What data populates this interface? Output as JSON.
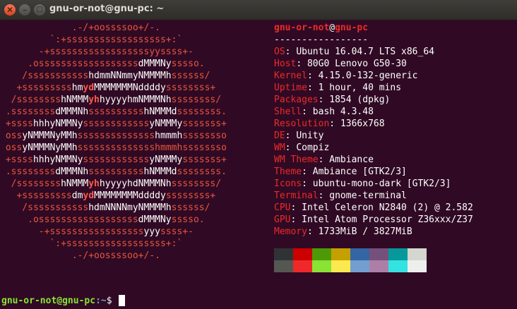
{
  "window": {
    "title": "gnu-or-not@gnu-pc: ~",
    "close_glyph": "✕",
    "minimize_glyph": "–",
    "maximize_glyph": "□"
  },
  "colors": {
    "background": "#300a24",
    "titlebar": "#3c3b37",
    "accent_red": "#ef2929",
    "logo_red": "#e9563e",
    "prompt_green": "#8ae234",
    "prompt_blue": "#729fcf"
  },
  "logo_lines": [
    [
      {
        "t": "             .-/+oossssoo+/-.",
        "s": "r"
      }
    ],
    [
      {
        "t": "         `:+ssssssssssssssssss+:`",
        "s": "r"
      }
    ],
    [
      {
        "t": "       -+ssssssssssssssssssyyssss+-",
        "s": "r"
      }
    ],
    [
      {
        "t": "     .ossssssssssssssssss",
        "s": "r"
      },
      {
        "t": "dMMMNy",
        "s": "w"
      },
      {
        "t": "sssso.",
        "s": "r"
      }
    ],
    [
      {
        "t": "    /sssssssssss",
        "s": "r"
      },
      {
        "t": "hdmmNNmmyNMMMMh",
        "s": "w"
      },
      {
        "t": "ssssss/",
        "s": "r"
      }
    ],
    [
      {
        "t": "   +sssssssss",
        "s": "r"
      },
      {
        "t": "hm",
        "s": "w"
      },
      {
        "t": "yd",
        "s": "b"
      },
      {
        "t": "MMMMMMMNddddy",
        "s": "w"
      },
      {
        "t": "ssssssss+",
        "s": "r"
      }
    ],
    [
      {
        "t": "  /ssssssss",
        "s": "r"
      },
      {
        "t": "hNMMM",
        "s": "w"
      },
      {
        "t": "yh",
        "s": "b"
      },
      {
        "t": "hyyyyhmNMMMNh",
        "s": "w"
      },
      {
        "t": "ssssssss/",
        "s": "r"
      }
    ],
    [
      {
        "t": " .ssssssss",
        "s": "r"
      },
      {
        "t": "dMMMNh",
        "s": "w"
      },
      {
        "t": "ssssssssss",
        "s": "r"
      },
      {
        "t": "hNMMMd",
        "s": "w"
      },
      {
        "t": "ssssssss.",
        "s": "r"
      }
    ],
    [
      {
        "t": " +ssss",
        "s": "r"
      },
      {
        "t": "hhhyNMMNy",
        "s": "w"
      },
      {
        "t": "ssssssssssss",
        "s": "r"
      },
      {
        "t": "yNMMMy",
        "s": "w"
      },
      {
        "t": "sssssss+",
        "s": "r"
      }
    ],
    [
      {
        "t": " oss",
        "s": "r"
      },
      {
        "t": "yNMMMNyMMh",
        "s": "w"
      },
      {
        "t": "ssssssssssssss",
        "s": "r"
      },
      {
        "t": "hmmmh",
        "s": "w"
      },
      {
        "t": "ssssssso",
        "s": "r"
      }
    ],
    [
      {
        "t": " oss",
        "s": "r"
      },
      {
        "t": "yNMMMNyMMh",
        "s": "w"
      },
      {
        "t": "sssssssssssssshmmmh",
        "s": "r"
      },
      {
        "t": "ssssssso",
        "s": "r"
      }
    ],
    [
      {
        "t": " +ssss",
        "s": "r"
      },
      {
        "t": "hhhyNMMNy",
        "s": "w"
      },
      {
        "t": "ssssssssssss",
        "s": "r"
      },
      {
        "t": "yNMMMy",
        "s": "w"
      },
      {
        "t": "sssssss+",
        "s": "r"
      }
    ],
    [
      {
        "t": " .ssssssss",
        "s": "r"
      },
      {
        "t": "dMMMNh",
        "s": "w"
      },
      {
        "t": "ssssssssss",
        "s": "r"
      },
      {
        "t": "hNMMMd",
        "s": "w"
      },
      {
        "t": "ssssssss.",
        "s": "r"
      }
    ],
    [
      {
        "t": "  /ssssssss",
        "s": "r"
      },
      {
        "t": "hNMMM",
        "s": "w"
      },
      {
        "t": "yh",
        "s": "b"
      },
      {
        "t": "hyyyyhdNMMMNh",
        "s": "w"
      },
      {
        "t": "ssssssss/",
        "s": "r"
      }
    ],
    [
      {
        "t": "   +sssssssss",
        "s": "r"
      },
      {
        "t": "dm",
        "s": "w"
      },
      {
        "t": "yd",
        "s": "b"
      },
      {
        "t": "MMMMMMMMddddy",
        "s": "w"
      },
      {
        "t": "ssssssss+",
        "s": "r"
      }
    ],
    [
      {
        "t": "    /sssssssssss",
        "s": "r"
      },
      {
        "t": "hdmNNNNmyNMMMMh",
        "s": "w"
      },
      {
        "t": "ssssss/",
        "s": "r"
      }
    ],
    [
      {
        "t": "     .ossssssssssssssssss",
        "s": "r"
      },
      {
        "t": "dMMMNy",
        "s": "w"
      },
      {
        "t": "sssso.",
        "s": "r"
      }
    ],
    [
      {
        "t": "       -+sssssssssssssssss",
        "s": "r"
      },
      {
        "t": "yyy",
        "s": "w"
      },
      {
        "t": "ssss+-",
        "s": "r"
      }
    ],
    [
      {
        "t": "         `:+ssssssssssssssssss+:`",
        "s": "r"
      }
    ],
    [
      {
        "t": "             .-/+oossssoo+/-.",
        "s": "r"
      }
    ]
  ],
  "header": {
    "user": "gnu-or-not",
    "at": "@",
    "host": "gnu-pc",
    "separator": "-----------------"
  },
  "info": [
    {
      "key": "OS",
      "value": "Ubuntu 16.04.7 LTS x86_64"
    },
    {
      "key": "Host",
      "value": "80G0 Lenovo G50-30"
    },
    {
      "key": "Kernel",
      "value": "4.15.0-132-generic"
    },
    {
      "key": "Uptime",
      "value": "1 hour, 40 mins"
    },
    {
      "key": "Packages",
      "value": "1854 (dpkg)"
    },
    {
      "key": "Shell",
      "value": "bash 4.3.48"
    },
    {
      "key": "Resolution",
      "value": "1366x768"
    },
    {
      "key": "DE",
      "value": "Unity"
    },
    {
      "key": "WM",
      "value": "Compiz"
    },
    {
      "key": "WM Theme",
      "value": "Ambiance"
    },
    {
      "key": "Theme",
      "value": "Ambiance [GTK2/3]"
    },
    {
      "key": "Icons",
      "value": "ubuntu-mono-dark [GTK2/3]"
    },
    {
      "key": "Terminal",
      "value": "gnome-terminal"
    },
    {
      "key": "CPU",
      "value": "Intel Celeron N2840 (2) @ 2.582"
    },
    {
      "key": "GPU",
      "value": "Intel Atom Processor Z36xxx/Z37"
    },
    {
      "key": "Memory",
      "value": "1733MiB / 3827MiB"
    }
  ],
  "palette": {
    "normal": [
      "#2e3436",
      "#cc0000",
      "#4e9a06",
      "#c4a000",
      "#3465a4",
      "#75507b",
      "#06989a",
      "#d3d7cf"
    ],
    "bright": [
      "#555753",
      "#ef2929",
      "#8ae234",
      "#fce94f",
      "#729fcf",
      "#ad7fa8",
      "#34e2e2",
      "#eeeeec"
    ]
  },
  "prompt": {
    "user_host": "gnu-or-not@gnu-pc",
    "path": ":~",
    "symbol": "$ "
  }
}
